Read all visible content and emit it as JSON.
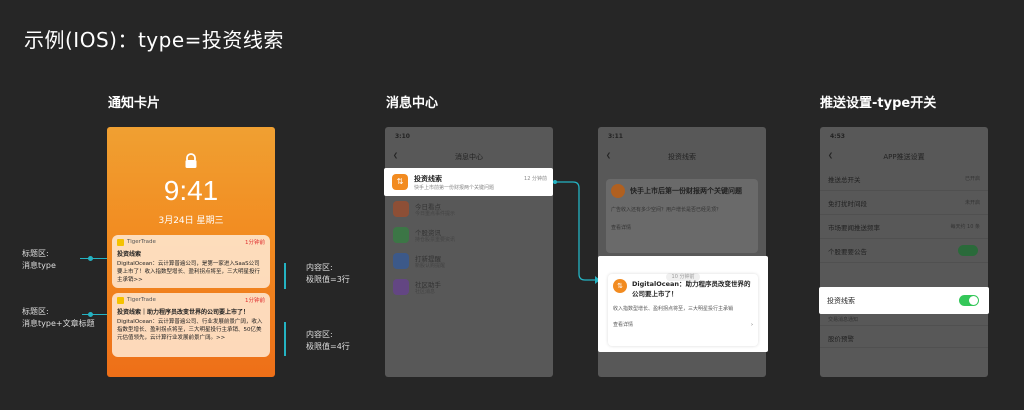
{
  "page_title": "示例(IOS)：type=投资线索",
  "sections": {
    "notify": "通知卡片",
    "msgcenter": "消息中心",
    "push": "推送设置-type开关"
  },
  "annotations": {
    "a1": "标题区:\n消息type",
    "a2": "标题区:\n消息type+文章标题",
    "a3": "内容区:\n极限值=3行",
    "a4": "内容区:\n极限值=4行"
  },
  "lock": {
    "time": "9:41",
    "date": "3月24日 星期三",
    "card1": {
      "app": "TigerTrade",
      "ago": "1分钟前",
      "title": "投资线索",
      "body": "DigitalOcean：云计算普遍公司，是第一家进入SaaS公司要上市了！收入指数型增长、盈利拐点将至，三大明星投行主承销>>"
    },
    "card2": {
      "app": "TigerTrade",
      "ago": "1分钟前",
      "title": "投资线索｜助力程序员改变世界的公司要上市了！",
      "body": "DigitalOcean：云计算普遍公司、行业发展前景广阔，收入指数型增长、盈利拐点将至，三大明星投行主承销、50亿美元估值领先，云计算行业发展前景广阔。>>"
    }
  },
  "msglist": {
    "time": "3:10",
    "header": "消息中心",
    "highlight": {
      "title": "投资线索",
      "sub": "快手上市前第一份财报两个关键问题",
      "ago": "12 分钟前"
    },
    "items": [
      {
        "title": "今日看点",
        "sub": "今日重点事件提示",
        "ago": ""
      },
      {
        "title": "个股资讯",
        "sub": "持仓股票重要资讯",
        "ago": ""
      },
      {
        "title": "打新提醒",
        "sub": "新股认购提醒",
        "ago": ""
      },
      {
        "title": "社区助手",
        "sub": "社区消息",
        "ago": ""
      }
    ]
  },
  "detail": {
    "time": "3:11",
    "header": "投资线索",
    "card1": {
      "title": "快手上市后第一份财报两个关键问题",
      "body": "广告收入还有多少空间？用户增长是否已经见顶？",
      "link": "查看详情"
    },
    "ago": "10 分钟前",
    "card2": {
      "title": "DigitalOcean：助力程序员改变世界的公司要上市了！",
      "body": "收入指数型增长、盈利拐点将至，三大明星投行主承销",
      "link": "查看详情"
    }
  },
  "settings": {
    "time": "4:53",
    "header": "APP推送设置",
    "rows": [
      {
        "label": "推送总开关",
        "value": "已开启"
      },
      {
        "label": "免打扰时间段",
        "value": "未开启"
      },
      {
        "label": "市场要闻推送频率",
        "value": "每天约 10 条"
      },
      {
        "label": "个股要要公告",
        "value": ""
      }
    ],
    "highlight": "投资线索",
    "after": [
      {
        "label": "订阅内容"
      },
      {
        "label": "股价预警"
      }
    ],
    "group": "交易消息通知"
  },
  "colors": {
    "accent": "#f29a14",
    "toggle": "#34c759",
    "link": "#24b3c2"
  }
}
